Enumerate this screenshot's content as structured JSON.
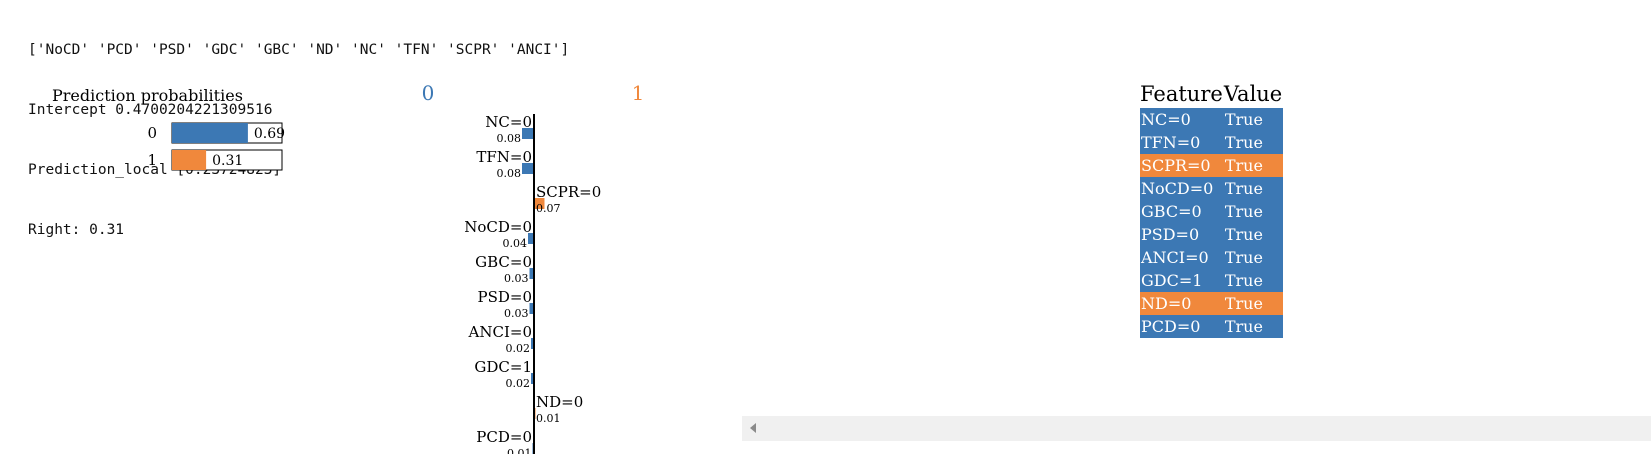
{
  "console": {
    "lines": [
      "['NoCD' 'PCD' 'PSD' 'GDC' 'GBC' 'ND' 'NC' 'TFN' 'SCPR' 'ANCI']",
      "Intercept 0.4700204221309516",
      "Prediction_local [0.23724823]",
      "Right: 0.31"
    ]
  },
  "colors": {
    "class0": "#3c78b4",
    "class1": "#f0883c"
  },
  "chart_data": [
    {
      "type": "bar",
      "title": "Prediction probabilities",
      "orientation": "horizontal",
      "categories": [
        "0",
        "1"
      ],
      "values": [
        0.69,
        0.31
      ],
      "value_labels": [
        "0.69",
        "0.31"
      ],
      "xlim": [
        0,
        1
      ]
    },
    {
      "type": "bar",
      "orientation": "horizontal",
      "class_labels": [
        "0",
        "1"
      ],
      "categories": [
        "NC=0",
        "TFN=0",
        "SCPR=0",
        "NoCD=0",
        "GBC=0",
        "PSD=0",
        "ANCI=0",
        "GDC=1",
        "ND=0",
        "PCD=0"
      ],
      "values": [
        0.08,
        0.08,
        0.07,
        0.04,
        0.03,
        0.03,
        0.02,
        0.02,
        0.01,
        0.01
      ],
      "value_labels": [
        "0.08",
        "0.08",
        "0.07",
        "0.04",
        "0.03",
        "0.03",
        "0.02",
        "0.02",
        "0.01",
        "0.01"
      ],
      "class": [
        "0",
        "0",
        "1",
        "0",
        "0",
        "0",
        "0",
        "0",
        "1",
        "0"
      ]
    },
    {
      "type": "table",
      "headers": [
        "Feature",
        "Value"
      ],
      "rows": [
        {
          "feature": "NC=0",
          "value": "True",
          "class": "0"
        },
        {
          "feature": "TFN=0",
          "value": "True",
          "class": "0"
        },
        {
          "feature": "SCPR=0",
          "value": "True",
          "class": "1"
        },
        {
          "feature": "NoCD=0",
          "value": "True",
          "class": "0"
        },
        {
          "feature": "GBC=0",
          "value": "True",
          "class": "0"
        },
        {
          "feature": "PSD=0",
          "value": "True",
          "class": "0"
        },
        {
          "feature": "ANCI=0",
          "value": "True",
          "class": "0"
        },
        {
          "feature": "GDC=1",
          "value": "True",
          "class": "0"
        },
        {
          "feature": "ND=0",
          "value": "True",
          "class": "1"
        },
        {
          "feature": "PCD=0",
          "value": "True",
          "class": "0"
        }
      ]
    }
  ]
}
